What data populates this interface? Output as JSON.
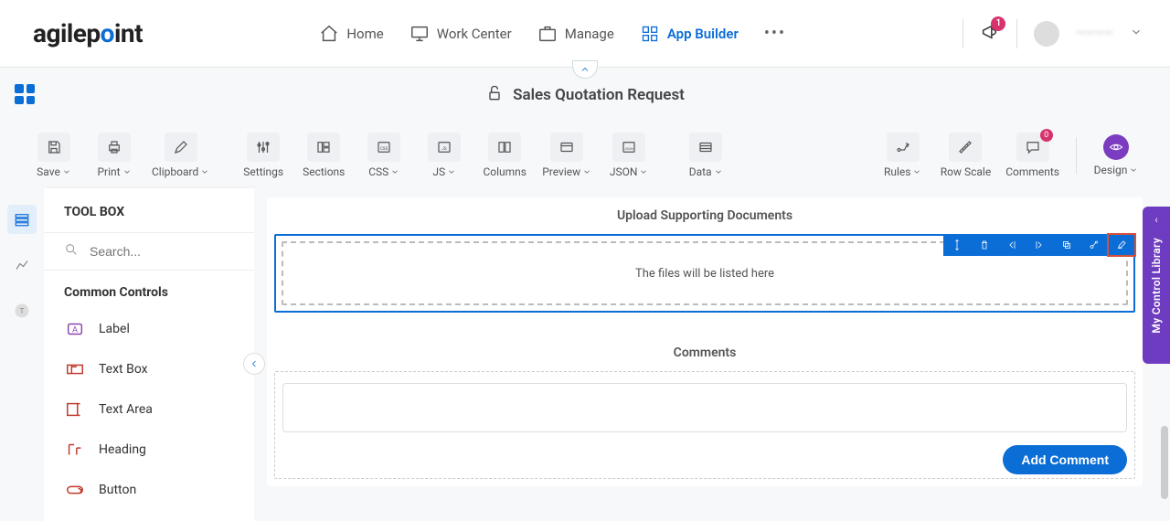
{
  "nav": {
    "logo_text": "agilepoint",
    "items": [
      {
        "label": "Home"
      },
      {
        "label": "Work Center"
      },
      {
        "label": "Manage"
      },
      {
        "label": "App Builder"
      }
    ],
    "notification_count": "1",
    "user_name": "————"
  },
  "page": {
    "title": "Sales Quotation Request"
  },
  "toolbar": {
    "save": "Save",
    "print": "Print",
    "clipboard": "Clipboard",
    "settings": "Settings",
    "sections": "Sections",
    "css": "CSS",
    "js": "JS",
    "columns": "Columns",
    "preview": "Preview",
    "json": "JSON",
    "data": "Data",
    "rules": "Rules",
    "row_scale": "Row Scale",
    "comments": "Comments",
    "comments_count": "0",
    "design": "Design"
  },
  "toolbox": {
    "title": "TOOL BOX",
    "search_placeholder": "Search...",
    "section_label": "Common Controls",
    "items": [
      "Label",
      "Text Box",
      "Text Area",
      "Heading",
      "Button"
    ]
  },
  "canvas": {
    "upload_title": "Upload Supporting Documents",
    "upload_placeholder": "The files will be listed here",
    "comments_title": "Comments",
    "add_comment": "Add Comment"
  },
  "side_tab": {
    "label": "My Control Library"
  }
}
